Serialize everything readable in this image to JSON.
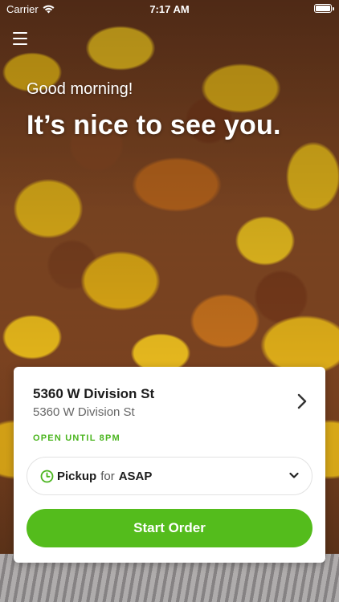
{
  "status_bar": {
    "carrier": "Carrier",
    "time": "7:17 AM",
    "icons": [
      "wifi-icon",
      "battery-icon"
    ]
  },
  "header": {
    "menu_icon": "hamburger-menu-icon",
    "greeting": "Good morning!",
    "headline": "It’s nice to see you."
  },
  "location_card": {
    "store_name": "5360 W Division St",
    "store_address": "5360 W Division St",
    "hours_status": "OPEN UNTIL 8PM",
    "chevron_icon": "chevron-right-icon"
  },
  "order_options": {
    "mode": "Pickup",
    "connector": "for",
    "time": "ASAP",
    "mode_icon": "clock-icon",
    "dropdown_icon": "chevron-down-icon"
  },
  "actions": {
    "start_order": "Start Order"
  },
  "colors": {
    "accent_green": "#54bc1c",
    "hours_green": "#4ab51e",
    "card_background": "#ffffff"
  }
}
